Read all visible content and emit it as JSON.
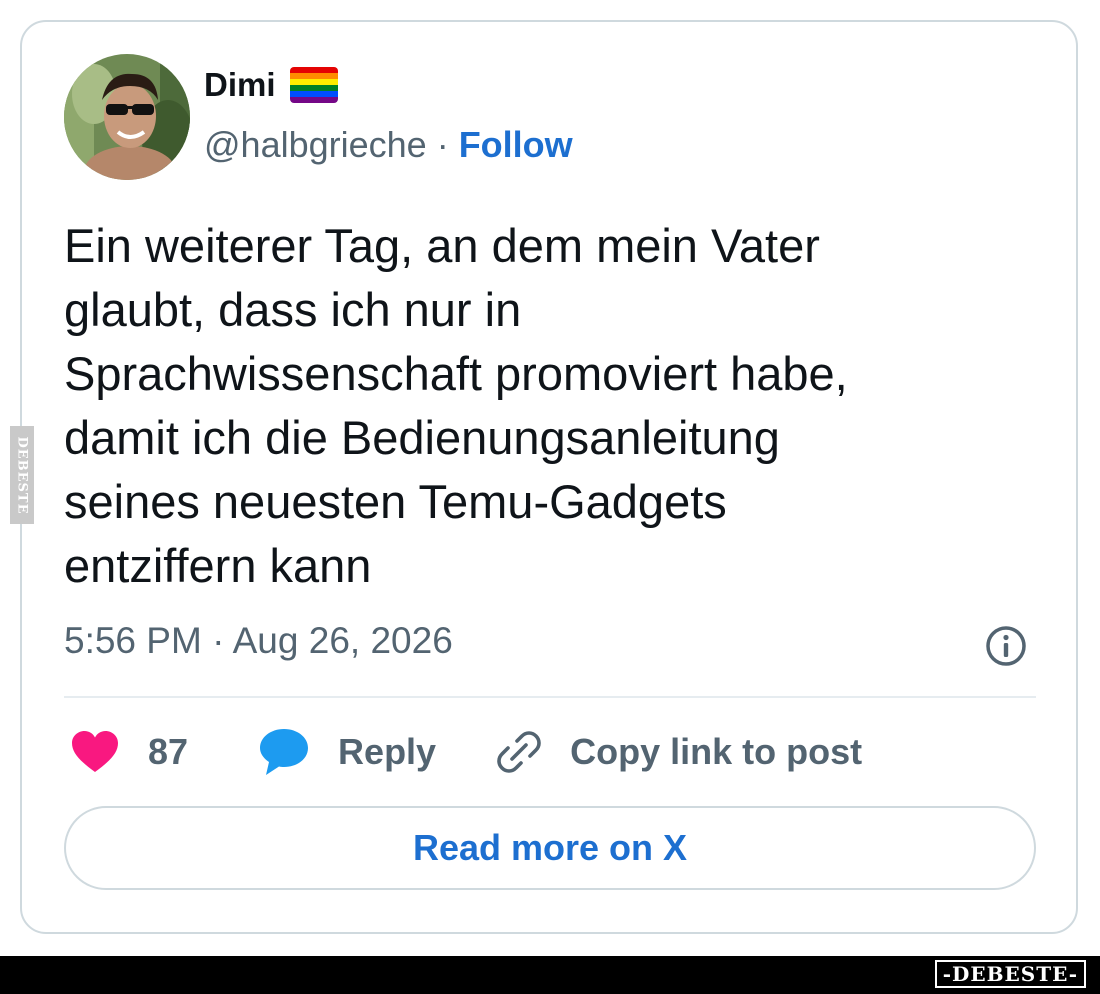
{
  "tweet": {
    "author": {
      "name": "Dimi",
      "flag": "rainbow-flag",
      "handle": "@halbgrieche",
      "separator": "·",
      "follow_label": "Follow"
    },
    "text": "Ein weiterer Tag, an dem mein Vater\nglaubt, dass ich nur in\nSprachwissenschaft promoviert habe,\ndamit ich die Bedienungsanleitung\nseines neuesten Temu-Gadgets\nentziffern kann",
    "timestamp": "5:56 PM · Aug 26, 2026",
    "info_icon": "info-circle-icon",
    "actions": {
      "like_count": "87",
      "reply_label": "Reply",
      "copy_link_label": "Copy link to post"
    },
    "read_more_label": "Read more on X"
  },
  "watermark": {
    "side_text": "DEBESTE",
    "footer_text": "-DEBESTE-"
  },
  "colors": {
    "follow": "#1d6fd0",
    "like": "#f91880",
    "reply": "#1d9bf0",
    "muted": "#536471",
    "border": "#cfd9de",
    "flag": [
      "#e40303",
      "#ff8c00",
      "#ffed00",
      "#008026",
      "#004dff",
      "#750787"
    ]
  }
}
